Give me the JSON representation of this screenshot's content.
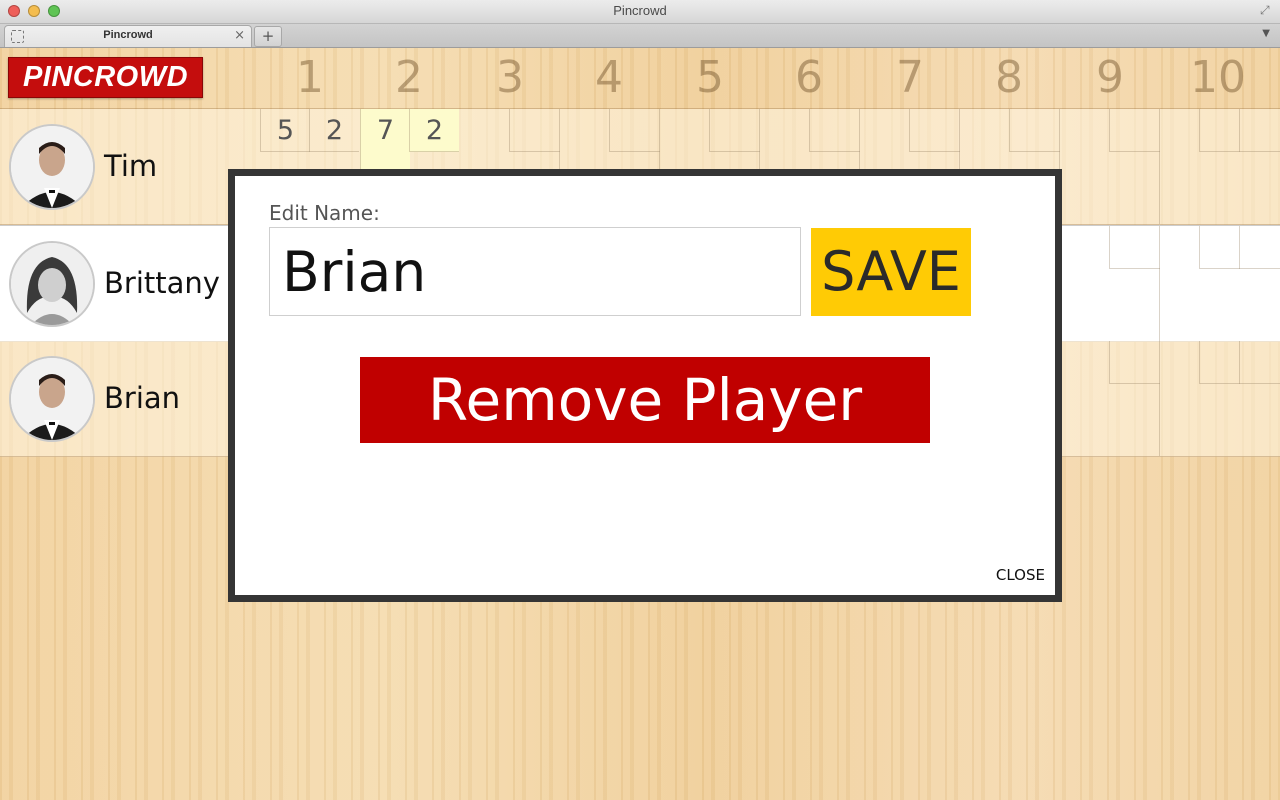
{
  "window": {
    "title": "Pincrowd"
  },
  "tabs": [
    {
      "label": "Pincrowd",
      "close_glyph": "×"
    }
  ],
  "new_tab_glyph": "+",
  "app": {
    "logo_text": "PINCROWD",
    "frames": [
      "1",
      "2",
      "3",
      "4",
      "5",
      "6",
      "7",
      "8",
      "9",
      "10"
    ]
  },
  "players": [
    {
      "name": "Tim",
      "scores": [
        "5",
        "2",
        "7",
        "2"
      ]
    },
    {
      "name": "Brittany",
      "scores": []
    },
    {
      "name": "Brian",
      "scores": []
    }
  ],
  "modal": {
    "label": "Edit Name:",
    "input_value": "Brian",
    "save_label": "SAVE",
    "remove_label": "Remove Player",
    "close_label": "CLOSE"
  },
  "colors": {
    "brand_red": "#c40d0d",
    "save_yellow": "#ffcb05",
    "remove_red": "#c00000",
    "modal_border": "#353535"
  }
}
